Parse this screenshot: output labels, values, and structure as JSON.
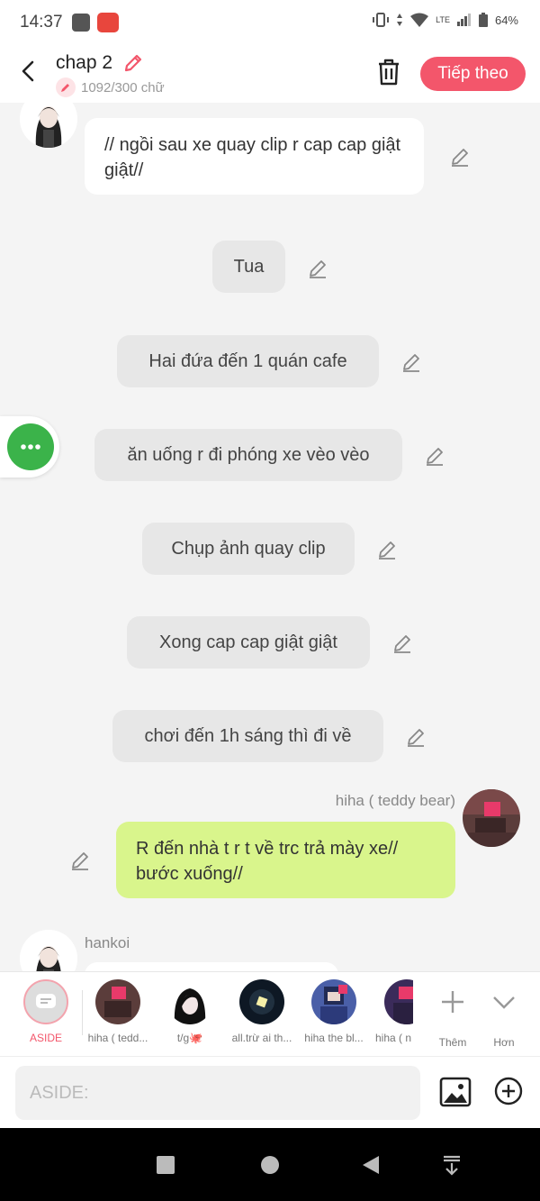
{
  "status": {
    "time": "14:37",
    "battery": "64%",
    "network": "LTE"
  },
  "header": {
    "title": "chap 2",
    "word_count": "1092/300 chữ",
    "next_label": "Tiếp theo",
    "accent": "#f3566b"
  },
  "messages": {
    "m1": "// ngồi sau xe quay clip r cap cap giật giật//",
    "n1": "Tua",
    "n2": "Hai đứa đến 1 quán cafe",
    "n3": "ăn uống r đi phóng xe vèo vèo",
    "n4": "Chụp ảnh quay clip",
    "n5": "Xong cap cap giật giật",
    "n6": "chơi đến 1h sáng thì đi về",
    "m2_name": "hiha ( teddy bear)",
    "m2": "R đến nhà t r t về trc trả mày xe// bước xuống//",
    "m3_name": "hankoi"
  },
  "characters": {
    "aside": "ASIDE",
    "c1": "hiha ( tedd...",
    "c2": "t/g🐙",
    "c3": "all.trừ ai th...",
    "c4": "hiha the bl...",
    "c5": "hiha ( n",
    "more": "Thêm",
    "collapse": "Hơn"
  },
  "input": {
    "placeholder": "ASIDE:"
  },
  "colors": {
    "bubble_green": "#d9f58c",
    "fab_green": "#3bb34a",
    "accent": "#f3566b"
  }
}
